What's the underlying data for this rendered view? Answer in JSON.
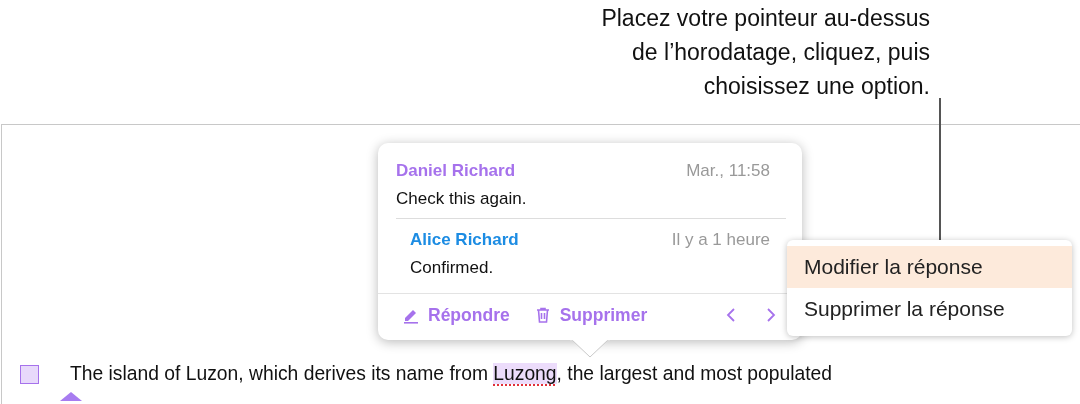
{
  "annotation": {
    "lines": [
      "Placez votre pointeur au-dessus",
      "de l’horodatage, cliquez, puis",
      "choisissez une option."
    ]
  },
  "comment_popover": {
    "comments": [
      {
        "kind": "comment",
        "author": "Daniel Richard",
        "color": "#a672ec",
        "time": "Mar., 11:58",
        "text": "Check this again."
      },
      {
        "kind": "reply",
        "author": "Alice Richard",
        "color": "#1c8ce3",
        "time": "Il y a 1 heure",
        "text": "Confirmed."
      }
    ],
    "actions": [
      {
        "kind": "reply",
        "label": "Répondre"
      },
      {
        "kind": "delete",
        "label": "Supprimer"
      }
    ]
  },
  "context_menu": {
    "items": [
      {
        "label": "Modifier la réponse",
        "selected": true
      },
      {
        "label": "Supprimer la réponse",
        "selected": false
      }
    ]
  },
  "document": {
    "text_before": "The island of Luzon, which derives its name from ",
    "anchor": "Luzong",
    "text_after": ", the largest and most populated"
  }
}
